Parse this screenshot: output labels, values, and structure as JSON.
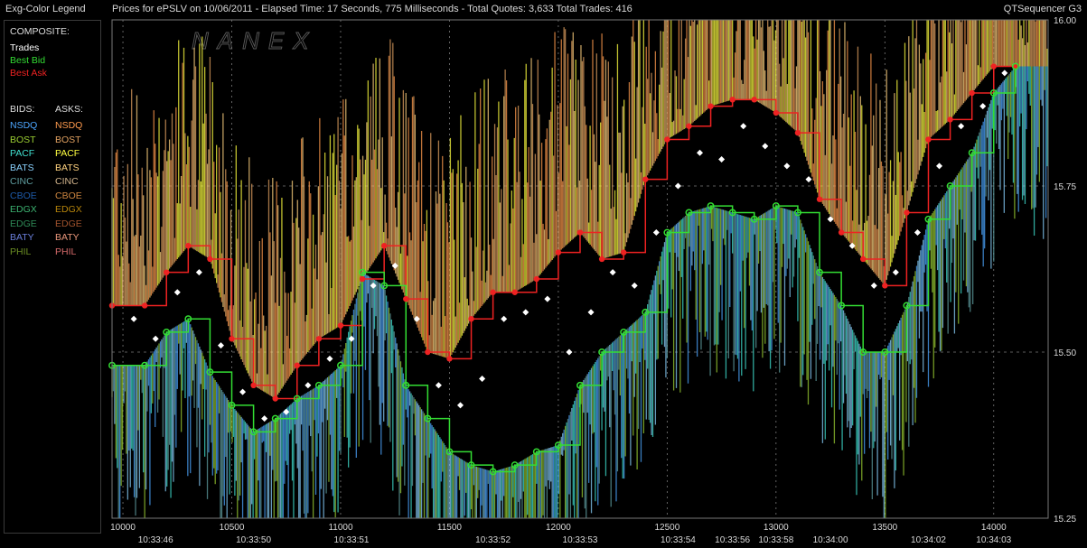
{
  "header": {
    "legend_title": "Exg-Color Legend",
    "chart_title": "Prices for  ePSLV  on  10/06/2011  -  Elapsed Time: 17 Seconds, 775 Milliseconds  -  Total Quotes: 3,633  Total Trades: 416",
    "app_name": "QTSequencer G3"
  },
  "legend": {
    "composite_label": "COMPOSITE:",
    "composite": [
      {
        "label": "Trades",
        "color": "#ffffff"
      },
      {
        "label": "Best Bid",
        "color": "#33dd33"
      },
      {
        "label": "Best Ask",
        "color": "#ee2222"
      }
    ],
    "bids_label": "BIDS:",
    "asks_label": "ASKS:",
    "exchanges": [
      {
        "bid": "NSDQ",
        "ask": "NSDQ",
        "bid_color": "#4da6ff",
        "ask_color": "#ff9a4d"
      },
      {
        "bid": "BOST",
        "ask": "BOST",
        "bid_color": "#9acd32",
        "ask_color": "#e0a060"
      },
      {
        "bid": "PACF",
        "ask": "PACF",
        "bid_color": "#40e0d0",
        "ask_color": "#ffff40"
      },
      {
        "bid": "BATS",
        "ask": "BATS",
        "bid_color": "#87cefa",
        "ask_color": "#ffd27f"
      },
      {
        "bid": "CINC",
        "ask": "CINC",
        "bid_color": "#5f9ea0",
        "ask_color": "#d2b48c"
      },
      {
        "bid": "CBOE",
        "ask": "CBOE",
        "bid_color": "#1e5aa8",
        "ask_color": "#cd853f"
      },
      {
        "bid": "EDGX",
        "ask": "EDGX",
        "bid_color": "#3cb371",
        "ask_color": "#b8860b"
      },
      {
        "bid": "EDGE",
        "ask": "EDGE",
        "bid_color": "#2e8b57",
        "ask_color": "#a0522d"
      },
      {
        "bid": "BATY",
        "ask": "BATY",
        "bid_color": "#6a7fdb",
        "ask_color": "#e9967a"
      },
      {
        "bid": "PHIL",
        "ask": "PHIL",
        "bid_color": "#6b8e23",
        "ask_color": "#d46a6a"
      }
    ]
  },
  "chart_data": {
    "type": "line",
    "xlim": [
      9950,
      14250
    ],
    "ylim": [
      15.25,
      16.0
    ],
    "x_ticks": [
      10000,
      10500,
      11000,
      11500,
      12000,
      12500,
      13000,
      13500,
      14000
    ],
    "y_ticks": [
      15.25,
      15.5,
      15.75,
      16.0
    ],
    "y_tick_labels": [
      "15.25",
      "15.50",
      "15.75",
      "16.00"
    ],
    "time_labels": [
      {
        "x": 10150,
        "label": "10:33:46"
      },
      {
        "x": 10600,
        "label": "10:33:50"
      },
      {
        "x": 11050,
        "label": "10:33:51"
      },
      {
        "x": 11700,
        "label": "10:33:52"
      },
      {
        "x": 12100,
        "label": "10:33:53"
      },
      {
        "x": 12550,
        "label": "10:33:54"
      },
      {
        "x": 12800,
        "label": "10:33:56"
      },
      {
        "x": 13000,
        "label": "10:33:58"
      },
      {
        "x": 13250,
        "label": "10:34:00"
      },
      {
        "x": 13700,
        "label": "10:34:02"
      },
      {
        "x": 14000,
        "label": "10:34:03"
      }
    ],
    "grid": true,
    "watermark": "NANEX",
    "series": [
      {
        "name": "Best Ask",
        "color": "#ee2222",
        "x": [
          9950,
          10100,
          10200,
          10300,
          10400,
          10500,
          10600,
          10700,
          10800,
          10900,
          11000,
          11100,
          11200,
          11300,
          11400,
          11500,
          11600,
          11700,
          11800,
          11900,
          12000,
          12100,
          12200,
          12300,
          12400,
          12500,
          12600,
          12700,
          12800,
          12900,
          13000,
          13100,
          13200,
          13300,
          13400,
          13500,
          13600,
          13700,
          13800,
          13900,
          14000,
          14100
        ],
        "values": [
          15.57,
          15.57,
          15.62,
          15.66,
          15.64,
          15.52,
          15.45,
          15.43,
          15.48,
          15.52,
          15.54,
          15.61,
          15.66,
          15.58,
          15.5,
          15.49,
          15.55,
          15.59,
          15.59,
          15.61,
          15.65,
          15.68,
          15.64,
          15.65,
          15.76,
          15.82,
          15.84,
          15.87,
          15.88,
          15.88,
          15.86,
          15.83,
          15.73,
          15.68,
          15.64,
          15.6,
          15.71,
          15.82,
          15.85,
          15.89,
          15.93,
          15.93
        ]
      },
      {
        "name": "Best Bid",
        "color": "#33dd33",
        "x": [
          9950,
          10100,
          10200,
          10300,
          10400,
          10500,
          10600,
          10700,
          10800,
          10900,
          11000,
          11100,
          11200,
          11300,
          11400,
          11500,
          11600,
          11700,
          11800,
          11900,
          12000,
          12100,
          12200,
          12300,
          12400,
          12500,
          12600,
          12700,
          12800,
          12900,
          13000,
          13100,
          13200,
          13300,
          13400,
          13500,
          13600,
          13700,
          13800,
          13900,
          14000,
          14100
        ],
        "values": [
          15.48,
          15.48,
          15.53,
          15.55,
          15.47,
          15.42,
          15.38,
          15.4,
          15.43,
          15.45,
          15.48,
          15.62,
          15.6,
          15.45,
          15.4,
          15.35,
          15.33,
          15.32,
          15.33,
          15.35,
          15.36,
          15.45,
          15.5,
          15.53,
          15.56,
          15.68,
          15.71,
          15.72,
          15.71,
          15.7,
          15.72,
          15.71,
          15.62,
          15.57,
          15.5,
          15.5,
          15.57,
          15.7,
          15.75,
          15.8,
          15.89,
          15.93
        ]
      },
      {
        "name": "Trades",
        "color": "#ffffff",
        "x": [
          10050,
          10150,
          10250,
          10350,
          10450,
          10550,
          10650,
          10750,
          10850,
          10950,
          11050,
          11150,
          11250,
          11350,
          11450,
          11550,
          11650,
          11750,
          11850,
          11950,
          12050,
          12150,
          12250,
          12350,
          12450,
          12550,
          12650,
          12750,
          12850,
          12950,
          13050,
          13150,
          13250,
          13350,
          13450,
          13550,
          13650,
          13750,
          13850,
          13950,
          14050
        ],
        "values": [
          15.55,
          15.52,
          15.59,
          15.62,
          15.51,
          15.44,
          15.4,
          15.41,
          15.45,
          15.49,
          15.52,
          15.6,
          15.63,
          15.55,
          15.45,
          15.42,
          15.46,
          15.55,
          15.56,
          15.58,
          15.5,
          15.56,
          15.62,
          15.6,
          15.68,
          15.75,
          15.8,
          15.79,
          15.84,
          15.81,
          15.78,
          15.76,
          15.7,
          15.66,
          15.6,
          15.62,
          15.68,
          15.78,
          15.84,
          15.87,
          15.92
        ]
      }
    ]
  }
}
